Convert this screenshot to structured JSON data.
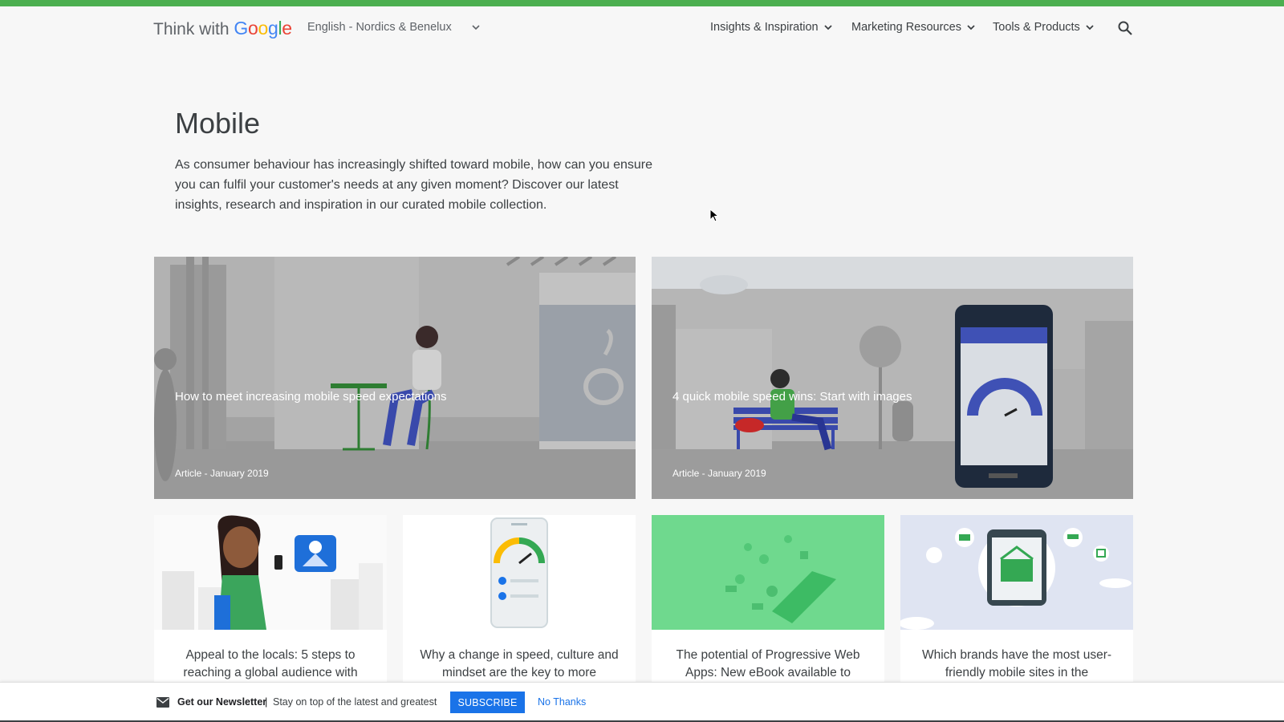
{
  "brand": {
    "prefix": "Think with",
    "google_letters": [
      "G",
      "o",
      "o",
      "g",
      "l",
      "e"
    ],
    "google_colors": [
      "#4285F4",
      "#EA4335",
      "#FBBC05",
      "#4285F4",
      "#34A853",
      "#EA4335"
    ]
  },
  "language_selector": {
    "label": "English - Nordics & Benelux"
  },
  "nav": {
    "items": [
      {
        "label": "Insights & Inspiration"
      },
      {
        "label": "Marketing Resources"
      },
      {
        "label": "Tools & Products"
      }
    ]
  },
  "hero": {
    "title": "Mobile",
    "description": "As consumer behaviour has increasingly shifted toward mobile, how can you ensure you can fulfil your customer's needs at any given moment? Discover our latest insights, research and inspiration in our curated mobile collection."
  },
  "featured": [
    {
      "title": "How to meet increasing mobile speed expectations",
      "meta": "Article - January 2019"
    },
    {
      "title": "4 quick mobile speed wins: Start with images",
      "meta": "Article - January 2019"
    }
  ],
  "cards": [
    {
      "title": "Appeal to the locals: 5 steps to reaching a global audience with"
    },
    {
      "title": "Why a change in speed, culture and mindset are the key to more"
    },
    {
      "title": "The potential of Progressive Web Apps: New eBook available to"
    },
    {
      "title": "Which brands have the most user-friendly mobile sites in the"
    }
  ],
  "newsletter": {
    "heading": "Get our Newsletter",
    "separator": "|",
    "text": "Stay on top of the latest and greatest",
    "subscribe_label": "SUBSCRIBE",
    "dismiss_label": "No Thanks"
  },
  "colors": {
    "top_bar": "#4caf50",
    "accent": "#1a73e8",
    "card_green": "#6fd98e"
  }
}
